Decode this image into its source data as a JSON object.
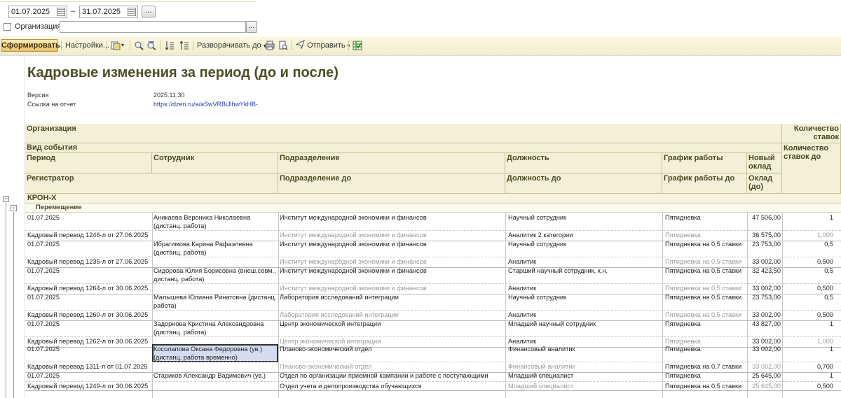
{
  "filters": {
    "date_from": "01.07.2025",
    "date_to": "31.07.2025",
    "dash": "–",
    "dots": "...",
    "org_label": "Организация:",
    "org_value": ""
  },
  "toolbar": {
    "form_label": "Сформировать",
    "settings_label": "Настройки...",
    "expand_label": "Разворачивать до",
    "send_label": "Отправить"
  },
  "report": {
    "title": "Кадровые изменения за период (до и после)",
    "version_key": "Версия",
    "version_val": "2025.11.30",
    "link_key": "Ссылка на отчет",
    "link_val": "https://dzen.ru/a/aSwVRBiJlhwYkHB-",
    "headers": {
      "org": "Организация",
      "event": "Вид события",
      "period": "Период",
      "employee": "Сотрудник",
      "dept": "Подразделение",
      "position": "Должность",
      "schedule": "График работы",
      "new_salary": "Новый оклад",
      "stakes": "Количество ставок",
      "stakes_before": "Количество ставок до",
      "registrar": "Регистратор",
      "dept_before": "Подразделение до",
      "position_before": "Должность до",
      "schedule_before": "График работы до",
      "salary_before": "Оклад (до)"
    },
    "group_org": "КРОН-Х",
    "group_event": "Перемещение",
    "rows": [
      {
        "period": "01.07.2025",
        "employee": "Аникаева Вероника Николаевна (дистанц. работа)",
        "dept": "Институт международной экономики и финансов",
        "position": "Научный сотрудник",
        "schedule": "Пятидневка",
        "salary": "47 506,00",
        "stakes": "1",
        "registrar": "Кадровый перевод 1246-л от 27.06.2025",
        "dept_before": "Институт международной экономики и финансов",
        "position_before": "Аналитик 2 категории",
        "schedule_before": "Пятидневка",
        "salary_before": "36 575,00",
        "stakes_before": "1,000"
      },
      {
        "period": "01.07.2025",
        "employee": "Ибрагимова Карина Рафаэлевна (дистанц. работа)",
        "dept": "Институт международной экономики и финансов",
        "position": "Научный сотрудник",
        "schedule": "Пятидневка на 0,5 ставки",
        "salary": "23 753,00",
        "stakes": "0,5",
        "registrar": "Кадровый перевод 1235-л от 27.06.2025",
        "dept_before": "Институт международной экономики и финансов",
        "position_before": "Аналитик",
        "schedule_before": "Пятидневка на 0,5 ставки",
        "salary_before": "33 002,00",
        "stakes_before": "0,500"
      },
      {
        "period": "01.07.2025",
        "employee": "Сидорова Юлия Борисовна (внеш.совм., дистанц. работа)",
        "dept": "Институт международной экономики и финансов",
        "position": "Старший научный сотрудник, к.н.",
        "schedule": "Пятидневка на 0,5 ставки",
        "salary": "32 423,50",
        "stakes": "0,5",
        "registrar": "Кадровый перевод 1264-л от 30.06.2025",
        "dept_before": "Институт международной экономики и финансов",
        "position_before": "Аналитик",
        "schedule_before": "Пятидневка на 0,5 ставки",
        "salary_before": "33 002,00",
        "stakes_before": "0,500"
      },
      {
        "period": "01.07.2025",
        "employee": "Малышева Юлиана Ринатовна (дистанц. работа)",
        "dept": "Лаборатория исследований интеграции",
        "position": "Научный сотрудник",
        "schedule": "Пятидневка на 0,5 ставки",
        "salary": "23 753,00",
        "stakes": "0,5",
        "registrar": "Кадровый перевод 1260-л от 30.06.2025",
        "dept_before": "Лаборатория исследований интеграции",
        "position_before": "Аналитик",
        "schedule_before": "Пятидневка на 0,5 ставки",
        "salary_before": "33 002,00",
        "stakes_before": "0,500"
      },
      {
        "period": "01.07.2025",
        "employee": "Задорнова Кристина Александровна (дистанц. работа)",
        "dept": "Центр экономической интеграции",
        "position": "Младший научный сотрудник",
        "schedule": "Пятидневка",
        "salary": "43 827,00",
        "stakes": "1",
        "registrar": "Кадровый перевод 1262-л от 30.06.2025",
        "dept_before": "Центр экономической интеграции",
        "position_before": "Аналитик",
        "schedule_before": "Пятидневка",
        "salary_before": "33 002,00",
        "stakes_before": "1,000"
      },
      {
        "period": "01.07.2025",
        "employee": "Косолапова Оксана Федоровна (ув.) (дистанц. работа временно)",
        "dept": "Планово-экономический отдел",
        "position": "Финансовый аналитик",
        "schedule": "Пятидневка",
        "salary": "33 002,00",
        "stakes": "1",
        "registrar": "Кадровый перевод 1311-л от 01.07.2025",
        "dept_before": "Планово-экономический отдел",
        "position_before": "Финансовый аналитик",
        "schedule_before": "Пятидневка на 0,7 ставки",
        "salary_before": "33 002,00",
        "stakes_before": "0,700"
      },
      {
        "period": "01.07.2025",
        "employee": "Стариков Александр Вадимович (ув.)",
        "dept": "Отдел по организации приемной кампании и работе с поступающими",
        "position": "Младший специалист",
        "schedule": "Пятидневка",
        "salary": "25 645,00",
        "stakes": "1",
        "registrar": "Кадровый перевод 1249-л от 30.06.2025",
        "dept_before": "Отдел учета и делопроизводства обучающихся",
        "position_before": "Младший специалист",
        "schedule_before": "Пятидневка на 0,5 ставки",
        "salary_before": "25 645,00",
        "stakes_before": "0,500"
      }
    ]
  }
}
